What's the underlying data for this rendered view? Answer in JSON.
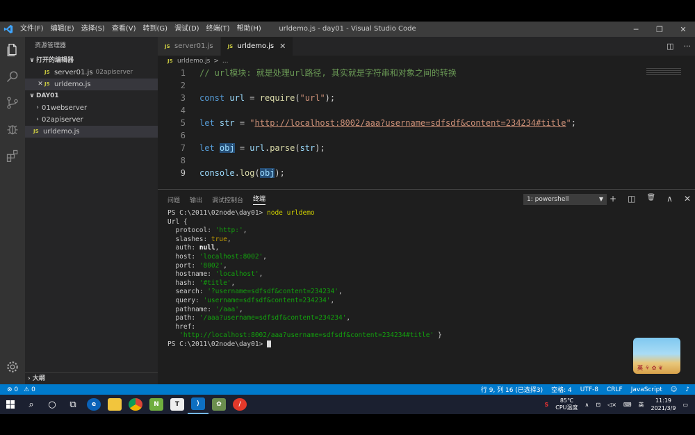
{
  "window": {
    "title": "urldemo.js - day01 - Visual Studio Code",
    "logo_icon": "vscode-icon",
    "menu": [
      "文件(F)",
      "编辑(E)",
      "选择(S)",
      "查看(V)",
      "转到(G)",
      "调试(D)",
      "终端(T)",
      "帮助(H)"
    ],
    "controls": [
      "─",
      "❐",
      "✕"
    ]
  },
  "activity_bar": {
    "icons": [
      "files-icon",
      "search-icon",
      "source-control-icon",
      "debug-icon",
      "extensions-icon"
    ],
    "bottom_icon": "settings-icon"
  },
  "sidebar": {
    "title": "资源管理器",
    "open_editors": {
      "label": "打开的编辑器",
      "items": [
        {
          "badge": "JS",
          "name": "server01.js",
          "folder": "02apiserver"
        },
        {
          "badge": "JS",
          "name": "urldemo.js",
          "close": "✕"
        }
      ]
    },
    "workspace": {
      "label": "DAY01",
      "items": [
        {
          "name": "01webserver"
        },
        {
          "name": "02apiserver"
        },
        {
          "badge": "JS",
          "name": "urldemo.js"
        }
      ]
    },
    "outline_label": "大纲"
  },
  "tabs": [
    {
      "badge": "JS",
      "label": "server01.js"
    },
    {
      "badge": "JS",
      "label": "urldemo.js",
      "close": "✕"
    }
  ],
  "breadcrumb": {
    "badge": "JS",
    "file": "urldemo.js",
    "sep": ">",
    "rest": "..."
  },
  "editor": {
    "lines": [
      {
        "n": "1",
        "tokens": [
          [
            "c-comment",
            "// url模块: 就是处理url路径, 其实就是字符串和对象之间的转换"
          ]
        ]
      },
      {
        "n": "2",
        "tokens": []
      },
      {
        "n": "3",
        "tokens": [
          [
            "c-kw",
            "const "
          ],
          [
            "c-var",
            "url"
          ],
          [
            "c-plain",
            " = "
          ],
          [
            "c-fn",
            "require"
          ],
          [
            "c-plain",
            "("
          ],
          [
            "c-str",
            "\"url\""
          ],
          [
            "c-plain",
            ");"
          ]
        ]
      },
      {
        "n": "4",
        "tokens": []
      },
      {
        "n": "5",
        "tokens": [
          [
            "c-kw",
            "let "
          ],
          [
            "c-var",
            "str"
          ],
          [
            "c-plain",
            " = "
          ],
          [
            "c-str",
            "\""
          ],
          [
            "c-url",
            "http://localhost:8002/aaa?username=sdfsdf&content=234234#title"
          ],
          [
            "c-str",
            "\""
          ],
          [
            "c-plain",
            ";"
          ]
        ]
      },
      {
        "n": "6",
        "tokens": []
      },
      {
        "n": "7",
        "tokens": [
          [
            "c-kw",
            "let "
          ],
          [
            "c-var hl",
            "obj"
          ],
          [
            "c-plain",
            " = "
          ],
          [
            "c-var",
            "url"
          ],
          [
            "c-plain",
            "."
          ],
          [
            "c-fn",
            "parse"
          ],
          [
            "c-plain",
            "("
          ],
          [
            "c-var",
            "str"
          ],
          [
            "c-plain",
            ");"
          ]
        ]
      },
      {
        "n": "8",
        "tokens": []
      },
      {
        "n": "9",
        "tokens": [
          [
            "c-var",
            "console"
          ],
          [
            "c-plain",
            "."
          ],
          [
            "c-fn",
            "log"
          ],
          [
            "c-plain",
            "("
          ],
          [
            "c-var hl",
            "obj"
          ],
          [
            "c-plain",
            ");"
          ]
        ]
      }
    ]
  },
  "panel": {
    "tabs": [
      "问题",
      "输出",
      "调试控制台",
      "终端"
    ],
    "active_tab": "终端",
    "terminal_select": "1: powershell",
    "actions": [
      "+",
      "◫",
      "🗑",
      "∧",
      "✕"
    ],
    "terminal_lines": [
      [
        [
          "t-plain",
          "PS C:\\2011\\02node\\day01> "
        ],
        [
          "t-cmd",
          "node urldemo"
        ]
      ],
      [
        [
          "t-plain",
          "Url {"
        ]
      ],
      [
        [
          "t-plain",
          "  protocol: "
        ],
        [
          "t-str",
          "'http:'"
        ],
        [
          "t-plain",
          ","
        ]
      ],
      [
        [
          "t-plain",
          "  slashes: "
        ],
        [
          "t-bool",
          "true"
        ],
        [
          "t-plain",
          ","
        ]
      ],
      [
        [
          "t-plain",
          "  auth: "
        ],
        [
          "t-null",
          "null"
        ],
        [
          "t-plain",
          ","
        ]
      ],
      [
        [
          "t-plain",
          "  host: "
        ],
        [
          "t-str",
          "'localhost:8002'"
        ],
        [
          "t-plain",
          ","
        ]
      ],
      [
        [
          "t-plain",
          "  port: "
        ],
        [
          "t-str",
          "'8002'"
        ],
        [
          "t-plain",
          ","
        ]
      ],
      [
        [
          "t-plain",
          "  hostname: "
        ],
        [
          "t-str",
          "'localhost'"
        ],
        [
          "t-plain",
          ","
        ]
      ],
      [
        [
          "t-plain",
          "  hash: "
        ],
        [
          "t-str",
          "'#title'"
        ],
        [
          "t-plain",
          ","
        ]
      ],
      [
        [
          "t-plain",
          "  search: "
        ],
        [
          "t-str",
          "'?username=sdfsdf&content=234234'"
        ],
        [
          "t-plain",
          ","
        ]
      ],
      [
        [
          "t-plain",
          "  query: "
        ],
        [
          "t-str",
          "'username=sdfsdf&content=234234'"
        ],
        [
          "t-plain",
          ","
        ]
      ],
      [
        [
          "t-plain",
          "  pathname: "
        ],
        [
          "t-str",
          "'/aaa'"
        ],
        [
          "t-plain",
          ","
        ]
      ],
      [
        [
          "t-plain",
          "  path: "
        ],
        [
          "t-str",
          "'/aaa?username=sdfsdf&content=234234'"
        ],
        [
          "t-plain",
          ","
        ]
      ],
      [
        [
          "t-plain",
          "  href:"
        ]
      ],
      [
        [
          "t-plain",
          "   "
        ],
        [
          "t-str",
          "'http://localhost:8002/aaa?username=sdfsdf&content=234234#title'"
        ],
        [
          "t-plain",
          " }"
        ]
      ],
      [
        [
          "t-plain",
          "PS C:\\2011\\02node\\day01> "
        ]
      ]
    ]
  },
  "thumbnail": {
    "text": "英 ⚘ ✿ ❦"
  },
  "statusbar": {
    "errors": "⊗ 0",
    "warnings": "⚠ 0",
    "position": "行 9, 列 16 (已选择3)",
    "indent": "空格: 4",
    "encoding": "UTF-8",
    "eol": "CRLF",
    "language": "JavaScript",
    "feedback_icon": "smiley-icon",
    "bell_icon": "bell-icon"
  },
  "taskbar": {
    "apps": [
      "start-icon",
      "search-icon",
      "cortana-icon",
      "task-view-icon",
      "edge-icon",
      "file-explorer-icon",
      "chrome-icon",
      "notepad-plus-icon",
      "typora-icon",
      "vscode-icon",
      "game-icon",
      "app-red-icon"
    ],
    "tray": {
      "temp": "85℃",
      "cpu_label": "CPU温度",
      "ime": "英",
      "time": "11:19",
      "date": "2021/3/9"
    }
  }
}
